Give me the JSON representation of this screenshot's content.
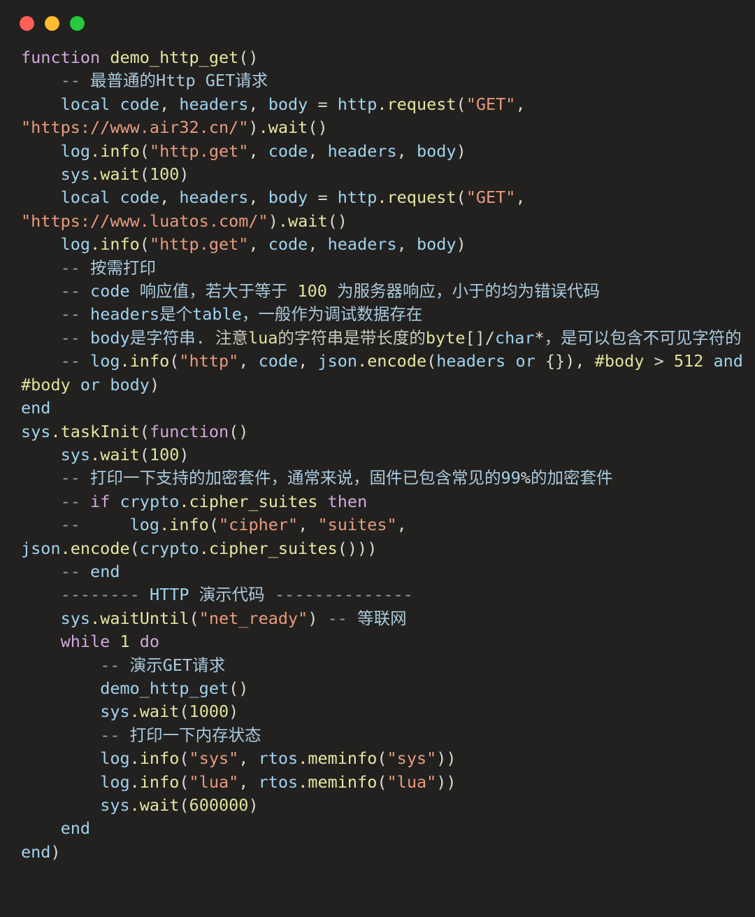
{
  "window": {
    "titlebar": {
      "buttons": [
        {
          "name": "close-button",
          "label": "close",
          "color": "#ff5f56"
        },
        {
          "name": "minimize-button",
          "label": "minimize",
          "color": "#ffbd2e"
        },
        {
          "name": "maximize-button",
          "label": "maximize",
          "color": "#27c93f"
        }
      ]
    }
  },
  "editor": {
    "language": "lua",
    "background": "#22211f",
    "theme_colors": {
      "keyword": "#d2a8de",
      "function": "#e8e6a0",
      "variable": "#9fd3f0",
      "string": "#e89b7e",
      "number": "#dde39a",
      "operator": "#d8d8d2",
      "comment": "#9aa0a6",
      "comment_cjk": "#a9c9de",
      "comment_cjk_alt": "#c9c9b8"
    },
    "lines": [
      {
        "id": "l1",
        "tokens": [
          {
            "c": "kw",
            "t": "function "
          },
          {
            "c": "fn",
            "t": "demo_http_get"
          },
          {
            "c": "pun",
            "t": "()"
          }
        ]
      },
      {
        "id": "l2",
        "tokens": [
          {
            "c": "cmt",
            "t": "    -- "
          },
          {
            "c": "cjk",
            "t": "最普通的Http GET请求"
          }
        ]
      },
      {
        "id": "l3",
        "tokens": [
          {
            "c": "var",
            "t": "    local code"
          },
          {
            "c": "pun",
            "t": ", "
          },
          {
            "c": "var",
            "t": "headers"
          },
          {
            "c": "pun",
            "t": ", "
          },
          {
            "c": "var",
            "t": "body "
          },
          {
            "c": "op",
            "t": "= "
          },
          {
            "c": "var",
            "t": "http"
          },
          {
            "c": "fn",
            "t": ".request"
          },
          {
            "c": "pun",
            "t": "("
          },
          {
            "c": "str",
            "t": "\"GET\""
          },
          {
            "c": "pun",
            "t": ", "
          },
          {
            "c": "str",
            "t": "\"https://www.air32.cn/\""
          },
          {
            "c": "pun",
            "t": ")"
          },
          {
            "c": "fn",
            "t": ".wait"
          },
          {
            "c": "pun",
            "t": "()"
          }
        ]
      },
      {
        "id": "l4",
        "tokens": [
          {
            "c": "var",
            "t": "    log"
          },
          {
            "c": "fn",
            "t": ".info"
          },
          {
            "c": "pun",
            "t": "("
          },
          {
            "c": "str",
            "t": "\"http.get\""
          },
          {
            "c": "pun",
            "t": ", "
          },
          {
            "c": "var",
            "t": "code"
          },
          {
            "c": "pun",
            "t": ", "
          },
          {
            "c": "var",
            "t": "headers"
          },
          {
            "c": "pun",
            "t": ", "
          },
          {
            "c": "var",
            "t": "body"
          },
          {
            "c": "pun",
            "t": ")"
          }
        ]
      },
      {
        "id": "l5",
        "tokens": [
          {
            "c": "var",
            "t": "    sys"
          },
          {
            "c": "fn",
            "t": ".wait"
          },
          {
            "c": "pun",
            "t": "("
          },
          {
            "c": "num",
            "t": "100"
          },
          {
            "c": "pun",
            "t": ")"
          }
        ]
      },
      {
        "id": "l6",
        "tokens": [
          {
            "c": "var",
            "t": "    local code"
          },
          {
            "c": "pun",
            "t": ", "
          },
          {
            "c": "var",
            "t": "headers"
          },
          {
            "c": "pun",
            "t": ", "
          },
          {
            "c": "var",
            "t": "body "
          },
          {
            "c": "op",
            "t": "= "
          },
          {
            "c": "var",
            "t": "http"
          },
          {
            "c": "fn",
            "t": ".request"
          },
          {
            "c": "pun",
            "t": "("
          },
          {
            "c": "str",
            "t": "\"GET\""
          },
          {
            "c": "pun",
            "t": ", "
          },
          {
            "c": "str",
            "t": "\"https://www.luatos.com/\""
          },
          {
            "c": "pun",
            "t": ")"
          },
          {
            "c": "fn",
            "t": ".wait"
          },
          {
            "c": "pun",
            "t": "()"
          }
        ]
      },
      {
        "id": "l7",
        "tokens": [
          {
            "c": "var",
            "t": "    log"
          },
          {
            "c": "fn",
            "t": ".info"
          },
          {
            "c": "pun",
            "t": "("
          },
          {
            "c": "str",
            "t": "\"http.get\""
          },
          {
            "c": "pun",
            "t": ", "
          },
          {
            "c": "var",
            "t": "code"
          },
          {
            "c": "pun",
            "t": ", "
          },
          {
            "c": "var",
            "t": "headers"
          },
          {
            "c": "pun",
            "t": ", "
          },
          {
            "c": "var",
            "t": "body"
          },
          {
            "c": "pun",
            "t": ")"
          }
        ]
      },
      {
        "id": "l8",
        "tokens": [
          {
            "c": "cmt",
            "t": "    -- "
          },
          {
            "c": "cjk",
            "t": "按需打印"
          }
        ]
      },
      {
        "id": "l9",
        "tokens": [
          {
            "c": "cmt",
            "t": "    -- "
          },
          {
            "c": "var",
            "t": "code "
          },
          {
            "c": "cjk",
            "t": "响应值，若大于等于 "
          },
          {
            "c": "num",
            "t": "100"
          },
          {
            "c": "cjk",
            "t": " 为服务器响应，小于的均为错误代码"
          }
        ]
      },
      {
        "id": "l10",
        "tokens": [
          {
            "c": "cmt",
            "t": "    -- "
          },
          {
            "c": "var",
            "t": "headers"
          },
          {
            "c": "cjk",
            "t": "是个"
          },
          {
            "c": "var",
            "t": "table"
          },
          {
            "c": "cjk",
            "t": "，一般作为调试数据存在"
          }
        ]
      },
      {
        "id": "l11",
        "tokens": [
          {
            "c": "cmt",
            "t": "    -- "
          },
          {
            "c": "var",
            "t": "body"
          },
          {
            "c": "cjk",
            "t": "是字符串. "
          },
          {
            "c": "cjk2",
            "t": "注意"
          },
          {
            "c": "num",
            "t": "lua"
          },
          {
            "c": "cjk2",
            "t": "的字符串是带长度的"
          },
          {
            "c": "num",
            "t": "byte"
          },
          {
            "c": "pun",
            "t": "[]/"
          },
          {
            "c": "var",
            "t": "char"
          },
          {
            "c": "pun",
            "t": "*"
          },
          {
            "c": "cjk",
            "t": "，是可以包含不可见字符的"
          }
        ]
      },
      {
        "id": "l12",
        "tokens": [
          {
            "c": "cmt",
            "t": "    -- "
          },
          {
            "c": "var",
            "t": "log"
          },
          {
            "c": "fn",
            "t": ".info"
          },
          {
            "c": "pun",
            "t": "("
          },
          {
            "c": "str",
            "t": "\"http\""
          },
          {
            "c": "pun",
            "t": ", "
          },
          {
            "c": "var",
            "t": "code"
          },
          {
            "c": "pun",
            "t": ", "
          },
          {
            "c": "var",
            "t": "json"
          },
          {
            "c": "fn",
            "t": ".encode"
          },
          {
            "c": "pun",
            "t": "("
          },
          {
            "c": "var",
            "t": "headers "
          },
          {
            "c": "var",
            "t": "or "
          },
          {
            "c": "pun",
            "t": "{}), "
          },
          {
            "c": "num",
            "t": "#body "
          },
          {
            "c": "op",
            "t": "> "
          },
          {
            "c": "num",
            "t": "512 "
          },
          {
            "c": "var",
            "t": "and "
          },
          {
            "c": "num",
            "t": "#body "
          },
          {
            "c": "var",
            "t": "or "
          },
          {
            "c": "var",
            "t": "body"
          },
          {
            "c": "pun",
            "t": ")"
          }
        ]
      },
      {
        "id": "l13",
        "tokens": [
          {
            "c": "var",
            "t": "end"
          }
        ]
      },
      {
        "id": "l14",
        "tokens": [
          {
            "c": "var",
            "t": "sys"
          },
          {
            "c": "fn",
            "t": ".taskInit"
          },
          {
            "c": "pun",
            "t": "("
          },
          {
            "c": "kw",
            "t": "function"
          },
          {
            "c": "pun",
            "t": "()"
          }
        ]
      },
      {
        "id": "l15",
        "tokens": [
          {
            "c": "var",
            "t": "    sys"
          },
          {
            "c": "fn",
            "t": ".wait"
          },
          {
            "c": "pun",
            "t": "("
          },
          {
            "c": "num",
            "t": "100"
          },
          {
            "c": "pun",
            "t": ")"
          }
        ]
      },
      {
        "id": "l16",
        "tokens": [
          {
            "c": "cmt",
            "t": "    -- "
          },
          {
            "c": "cjk",
            "t": "打印一下支持的加密套件，通常来说，固件已包含常见的"
          },
          {
            "c": "var",
            "t": "99"
          },
          {
            "c": "pun",
            "t": "%"
          },
          {
            "c": "cjk",
            "t": "的加密套件"
          }
        ]
      },
      {
        "id": "l17",
        "tokens": [
          {
            "c": "cmt",
            "t": "    -- "
          },
          {
            "c": "kw",
            "t": "if "
          },
          {
            "c": "var",
            "t": "crypto"
          },
          {
            "c": "fn",
            "t": ".cipher_suites "
          },
          {
            "c": "kw",
            "t": "then"
          }
        ]
      },
      {
        "id": "l18",
        "tokens": [
          {
            "c": "cmt",
            "t": "    --     "
          },
          {
            "c": "var",
            "t": "log"
          },
          {
            "c": "fn",
            "t": ".info"
          },
          {
            "c": "pun",
            "t": "("
          },
          {
            "c": "str",
            "t": "\"cipher\""
          },
          {
            "c": "pun",
            "t": ", "
          },
          {
            "c": "str",
            "t": "\"suites\""
          },
          {
            "c": "pun",
            "t": ", "
          },
          {
            "c": "var",
            "t": "json"
          },
          {
            "c": "fn",
            "t": ".encode"
          },
          {
            "c": "pun",
            "t": "("
          },
          {
            "c": "var",
            "t": "crypto"
          },
          {
            "c": "fn",
            "t": ".cipher_suites"
          },
          {
            "c": "pun",
            "t": "()))"
          }
        ]
      },
      {
        "id": "l19",
        "tokens": [
          {
            "c": "cmt",
            "t": "    -- "
          },
          {
            "c": "var",
            "t": "end"
          }
        ]
      },
      {
        "id": "l20",
        "tokens": [
          {
            "c": "cmt",
            "t": "    -------- "
          },
          {
            "c": "var",
            "t": "HTTP "
          },
          {
            "c": "cjk",
            "t": "演示代码 "
          },
          {
            "c": "cmt",
            "t": "--------------"
          }
        ]
      },
      {
        "id": "l21",
        "tokens": [
          {
            "c": "var",
            "t": "    sys"
          },
          {
            "c": "fn",
            "t": ".waitUntil"
          },
          {
            "c": "pun",
            "t": "("
          },
          {
            "c": "str",
            "t": "\"net_ready\""
          },
          {
            "c": "pun",
            "t": ") "
          },
          {
            "c": "cmt",
            "t": "-- "
          },
          {
            "c": "cjk",
            "t": "等联网"
          }
        ]
      },
      {
        "id": "l22",
        "tokens": [
          {
            "c": "kw",
            "t": "    while "
          },
          {
            "c": "num",
            "t": "1 "
          },
          {
            "c": "kw",
            "t": "do"
          }
        ]
      },
      {
        "id": "l23",
        "tokens": [
          {
            "c": "cmt",
            "t": "        -- "
          },
          {
            "c": "cjk",
            "t": "演示GET请求"
          }
        ]
      },
      {
        "id": "l24",
        "tokens": [
          {
            "c": "var",
            "t": "        demo_http_get"
          },
          {
            "c": "pun",
            "t": "()"
          }
        ]
      },
      {
        "id": "l25",
        "tokens": [
          {
            "c": "var",
            "t": "        sys"
          },
          {
            "c": "fn",
            "t": ".wait"
          },
          {
            "c": "pun",
            "t": "("
          },
          {
            "c": "num",
            "t": "1000"
          },
          {
            "c": "pun",
            "t": ")"
          }
        ]
      },
      {
        "id": "l26",
        "tokens": [
          {
            "c": "cmt",
            "t": "        -- "
          },
          {
            "c": "cjk",
            "t": "打印一下内存状态"
          }
        ]
      },
      {
        "id": "l27",
        "tokens": [
          {
            "c": "var",
            "t": "        log"
          },
          {
            "c": "fn",
            "t": ".info"
          },
          {
            "c": "pun",
            "t": "("
          },
          {
            "c": "str",
            "t": "\"sys\""
          },
          {
            "c": "pun",
            "t": ", "
          },
          {
            "c": "var",
            "t": "rtos"
          },
          {
            "c": "fn",
            "t": ".meminfo"
          },
          {
            "c": "pun",
            "t": "("
          },
          {
            "c": "str",
            "t": "\"sys\""
          },
          {
            "c": "pun",
            "t": "))"
          }
        ]
      },
      {
        "id": "l28",
        "tokens": [
          {
            "c": "var",
            "t": "        log"
          },
          {
            "c": "fn",
            "t": ".info"
          },
          {
            "c": "pun",
            "t": "("
          },
          {
            "c": "str",
            "t": "\"lua\""
          },
          {
            "c": "pun",
            "t": ", "
          },
          {
            "c": "var",
            "t": "rtos"
          },
          {
            "c": "fn",
            "t": ".meminfo"
          },
          {
            "c": "pun",
            "t": "("
          },
          {
            "c": "str",
            "t": "\"lua\""
          },
          {
            "c": "pun",
            "t": "))"
          }
        ]
      },
      {
        "id": "l29",
        "tokens": [
          {
            "c": "var",
            "t": "        sys"
          },
          {
            "c": "fn",
            "t": ".wait"
          },
          {
            "c": "pun",
            "t": "("
          },
          {
            "c": "num",
            "t": "600000"
          },
          {
            "c": "pun",
            "t": ")"
          }
        ]
      },
      {
        "id": "l30",
        "tokens": [
          {
            "c": "var",
            "t": "    end"
          }
        ]
      },
      {
        "id": "l31",
        "tokens": [
          {
            "c": "var",
            "t": "end"
          },
          {
            "c": "pun",
            "t": ")"
          }
        ]
      }
    ]
  }
}
